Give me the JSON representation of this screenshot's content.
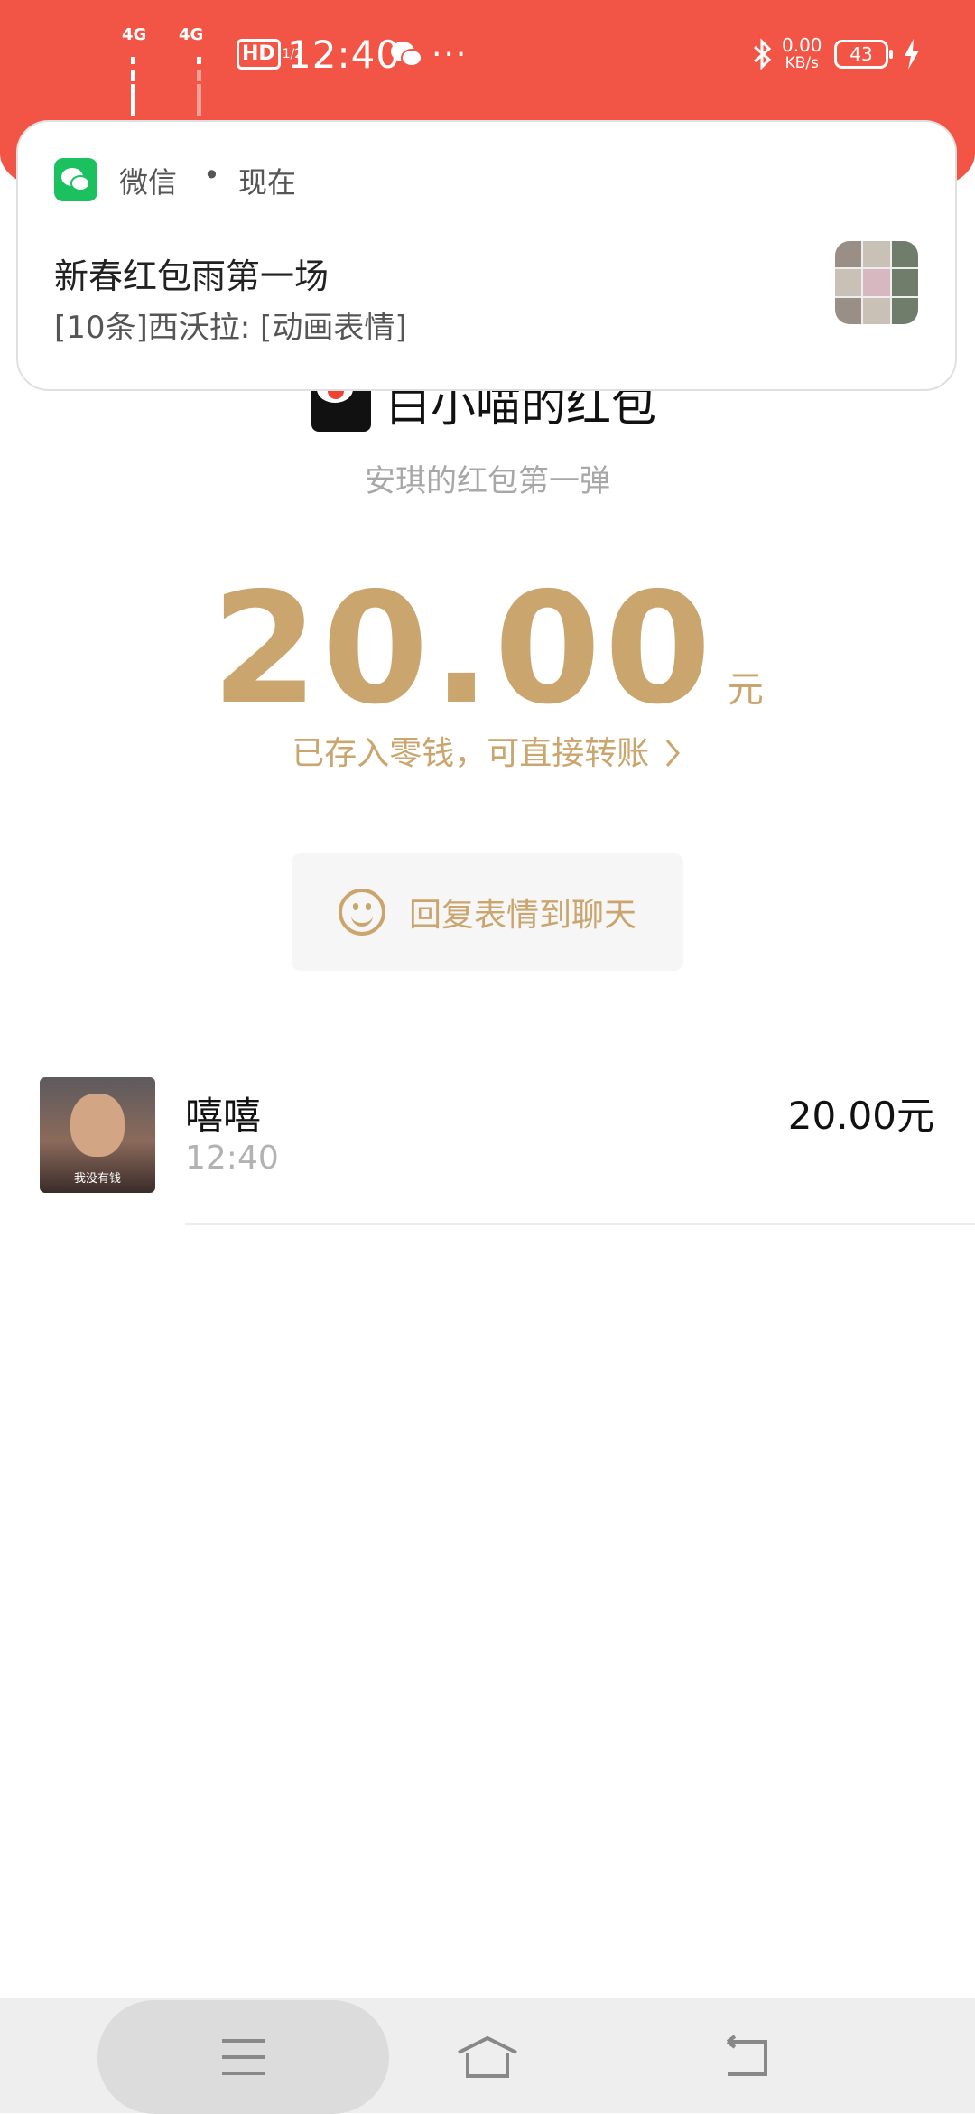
{
  "colors": {
    "header_red": "#f25545",
    "gold": "#caa56d",
    "wechat_green": "#1bc15f"
  },
  "status_bar": {
    "net1": "4G",
    "net2": "4G",
    "hd": "HD",
    "hd_sub": "1/2",
    "time": "12:40",
    "speed_value": "0.00",
    "speed_unit": "KB/s",
    "battery": "43",
    "icons": [
      "signal-icon",
      "hd-icon",
      "wechat-status-icon",
      "more-icon",
      "bluetooth-icon",
      "charging-icon"
    ]
  },
  "notification": {
    "app": "微信",
    "dot": "•",
    "when": "现在",
    "title": "新春红包雨第一场",
    "body": "[10条]西沃拉: [动画表情]"
  },
  "envelope": {
    "sender_title": "白小喵的红包",
    "blessing": "安琪的红包第一弹",
    "amount": "20.00",
    "unit": "元",
    "stored": "已存入零钱，可直接转账"
  },
  "reply_button": {
    "label": "回复表情到聊天"
  },
  "records": [
    {
      "name": "嘻嘻",
      "time": "12:40",
      "amount": "20.00元",
      "avatar_caption": "我没有钱"
    }
  ]
}
